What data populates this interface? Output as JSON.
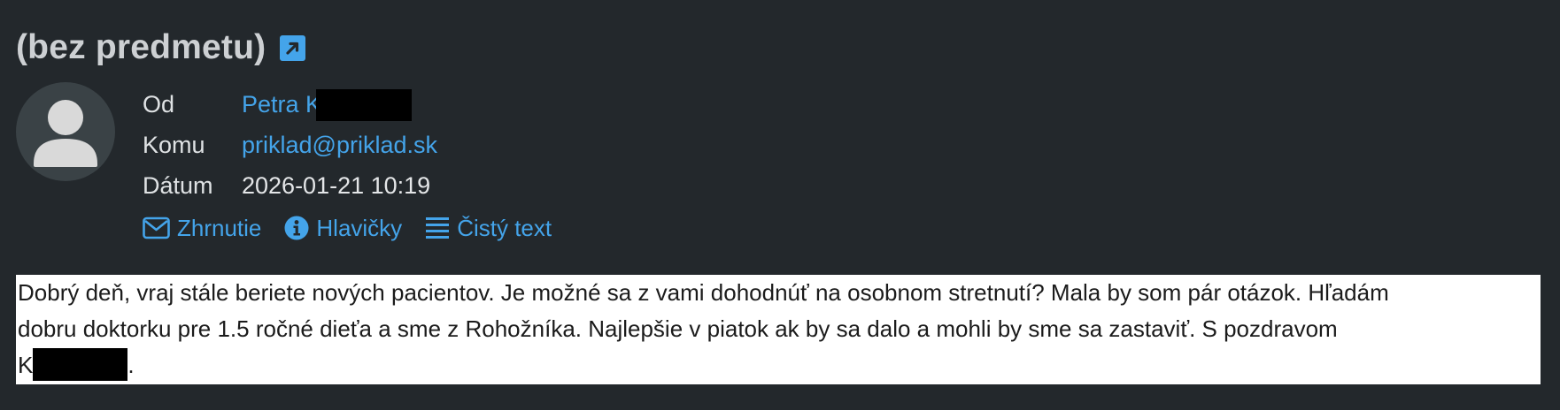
{
  "email": {
    "subject": "(bez predmetu)",
    "from_label": "Od",
    "from_value": "Petra K",
    "to_label": "Komu",
    "to_value": "priklad@priklad.sk",
    "date_label": "Dátum",
    "date_value": "2026-01-21 10:19"
  },
  "actions": {
    "summary": "Zhrnutie",
    "headers": "Hlavičky",
    "plain_text": "Čistý text"
  },
  "message": {
    "line1": "Dobrý deň, vraj stále beriete nových pacientov. Je možné sa z vami dohodnúť na osobnom stretnutí? Mala by som pár otázok. Hľadám",
    "line2": "dobru doktorku pre 1.5 ročné dieťa a sme z Rohožníka. Najlepšie v piatok ak by sa dalo a mohli by sme sa zastaviť. S pozdravom",
    "line3_start": "K",
    "line3_end": "."
  },
  "icons": {
    "open_external": "external-link-icon",
    "avatar": "user-avatar-icon",
    "summary": "envelope-icon",
    "headers": "info-icon",
    "plain_text": "lines-icon"
  },
  "colors": {
    "background": "#23282c",
    "link": "#44a4ea",
    "text": "#e4e6e8",
    "message_bg": "#ffffff"
  }
}
